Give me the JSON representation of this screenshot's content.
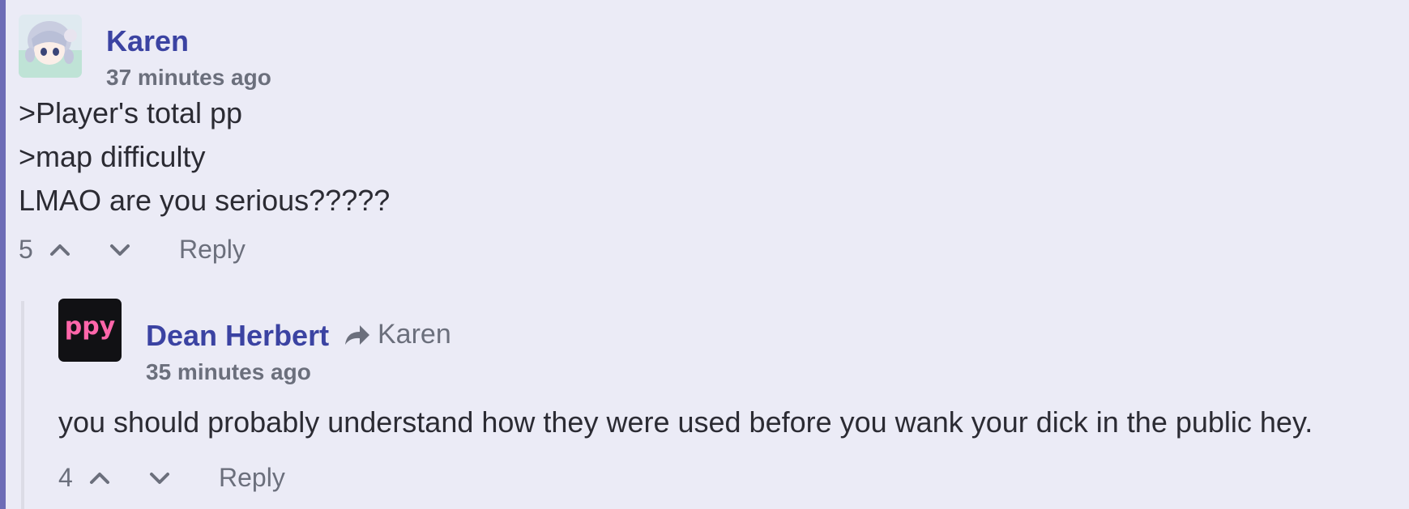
{
  "thread": {
    "comments": [
      {
        "author": "Karen",
        "time": "37 minutes ago",
        "body_lines": [
          ">Player's total pp",
          ">map difficulty",
          "LMAO are you serious?????"
        ],
        "score": "5",
        "reply_label": "Reply",
        "avatar_icon": "anime-girl-avatar"
      },
      {
        "author": "Dean Herbert",
        "reply_to": "Karen",
        "time": "35 minutes ago",
        "body_lines": [
          "you should probably understand how they were used before you wank your dick in the public hey."
        ],
        "score": "4",
        "reply_label": "Reply",
        "avatar_icon": "ppy-logo-avatar",
        "avatar_text": "ppy"
      }
    ]
  },
  "colors": {
    "background": "#ebebf6",
    "thread_accent": "#6d6cb6",
    "author": "#3b43a2",
    "muted": "#6b6f7c",
    "text": "#2b2b33"
  }
}
